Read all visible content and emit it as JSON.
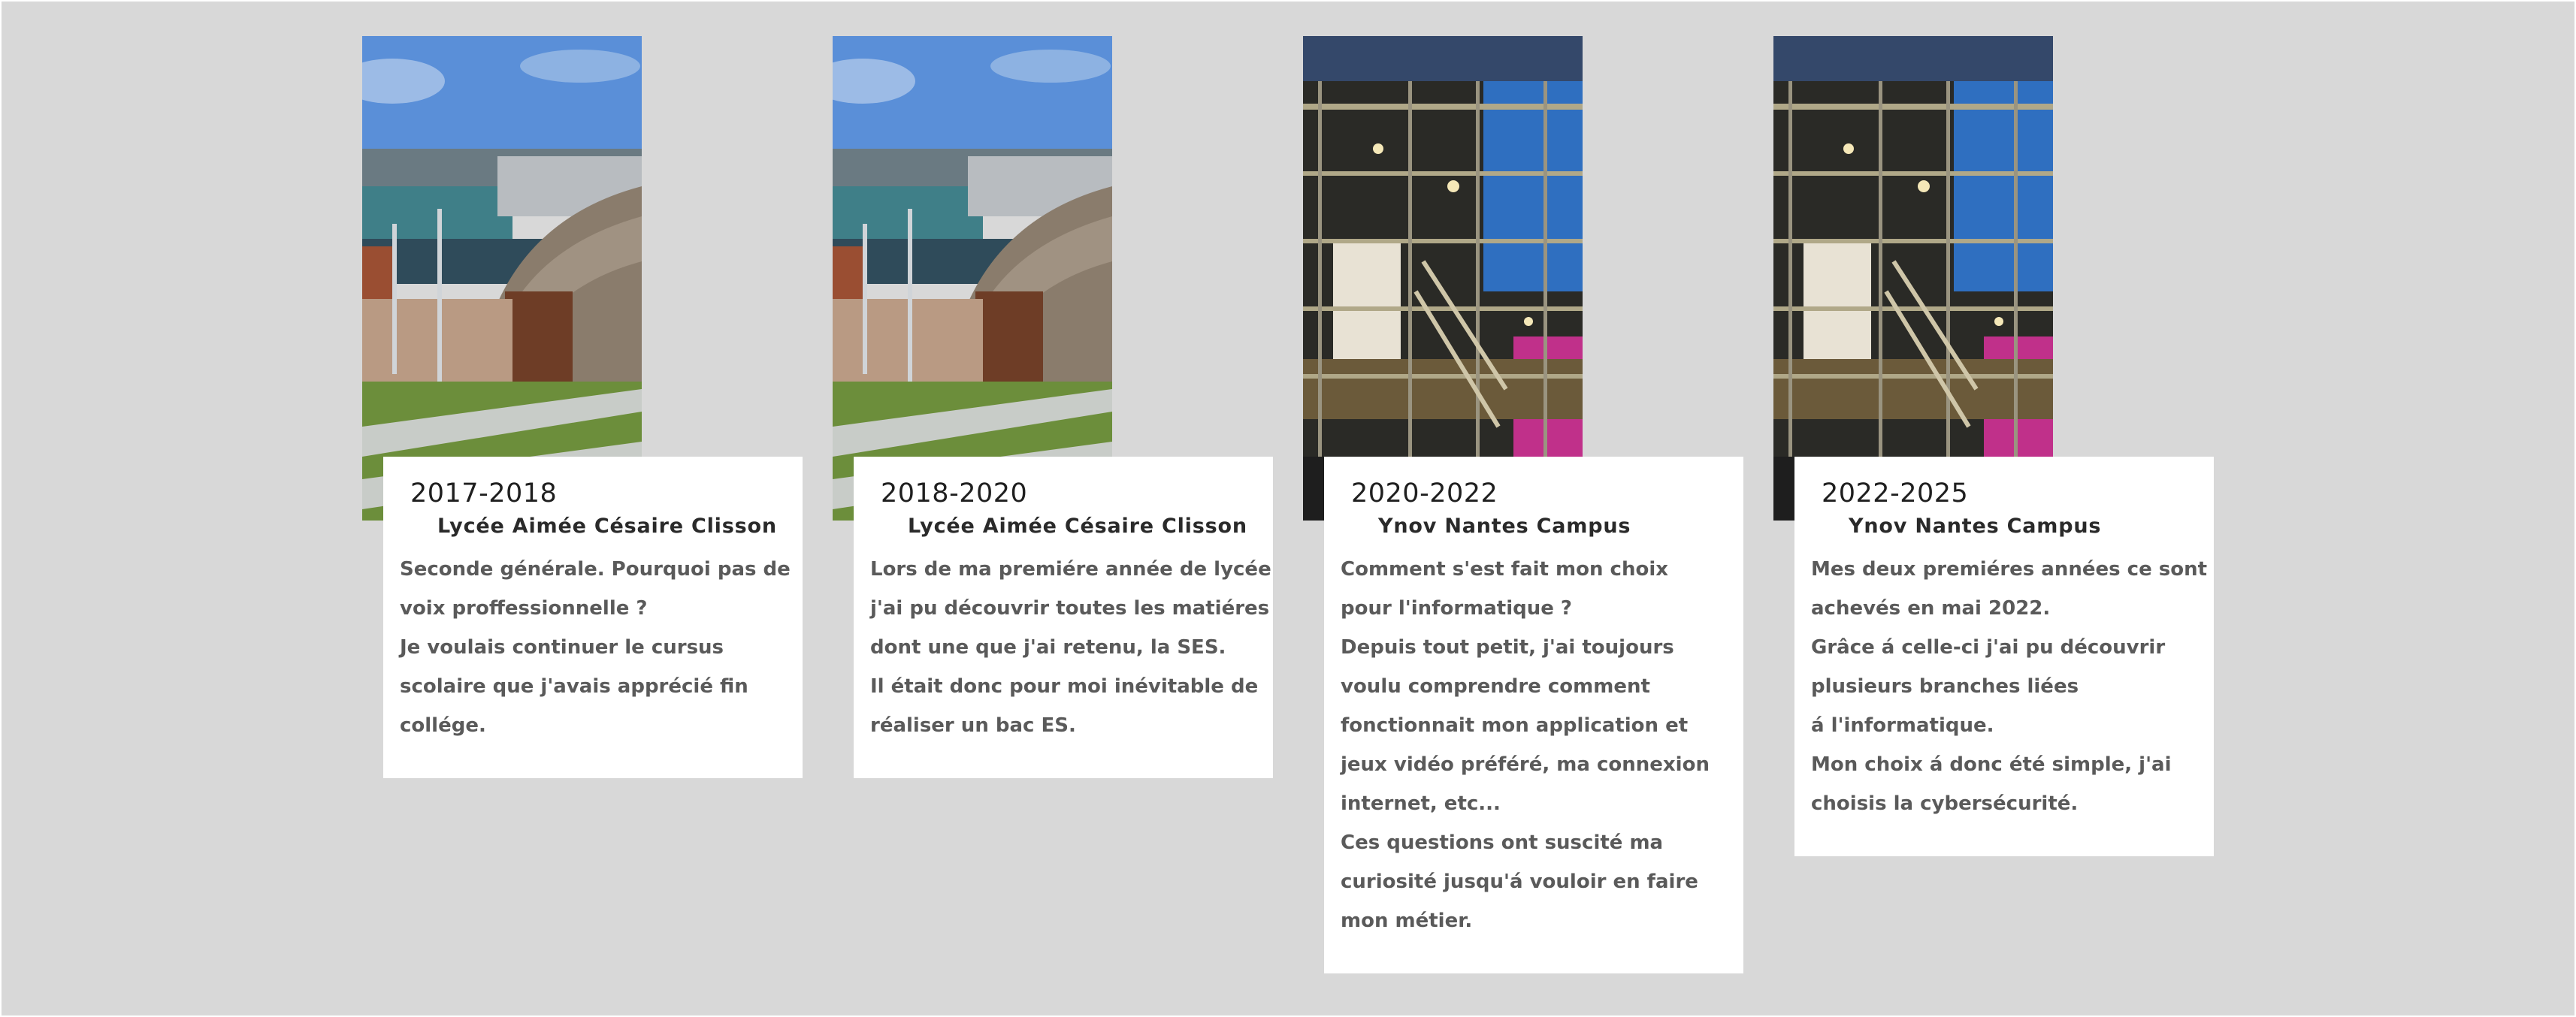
{
  "cards": [
    {
      "period": "2017-2018",
      "school": "Lycée Aimée Césaire Clisson",
      "image": "school-building-photo",
      "lines": [
        "Seconde générale. Pourquoi pas de",
        "voix proffessionnelle ?",
        "Je voulais continuer le cursus",
        "scolaire que j'avais apprécié fin",
        "collége."
      ]
    },
    {
      "period": "2018-2020",
      "school": "Lycée Aimée Césaire Clisson",
      "image": "school-building-photo",
      "lines": [
        "Lors de ma premiére année de lycée",
        "j'ai pu découvrir  toutes les matiéres",
        "dont une que j'ai retenu, la SES.",
        "Il était donc pour moi inévitable de",
        "réaliser un bac ES."
      ]
    },
    {
      "period": "2020-2022",
      "school": "Ynov Nantes Campus",
      "image": "campus-building-photo",
      "lines": [
        "Comment s'est fait mon choix",
        "pour l'informatique ?",
        "Depuis tout petit, j'ai toujours",
        "voulu comprendre comment",
        "fonctionnait mon application et",
        "jeux vidéo préféré, ma connexion",
        "internet, etc...",
        "Ces questions ont suscité ma",
        "curiosité jusqu'á vouloir en faire",
        "mon métier."
      ]
    },
    {
      "period": "2022-2025",
      "school": "Ynov Nantes Campus",
      "image": "campus-building-photo",
      "lines": [
        "Mes deux premiéres années ce sont",
        "achevés en mai 2022.",
        "Grâce á celle-ci j'ai pu découvrir",
        "plusieurs branches liées",
        "á l'informatique.",
        "Mon choix á donc été simple, j'ai",
        "choisis la cybersécurité."
      ]
    }
  ],
  "colors": {
    "background": "#d8d8d8",
    "card": "#ffffff",
    "title": "#1f1f1f",
    "body": "#5a5a5a"
  }
}
